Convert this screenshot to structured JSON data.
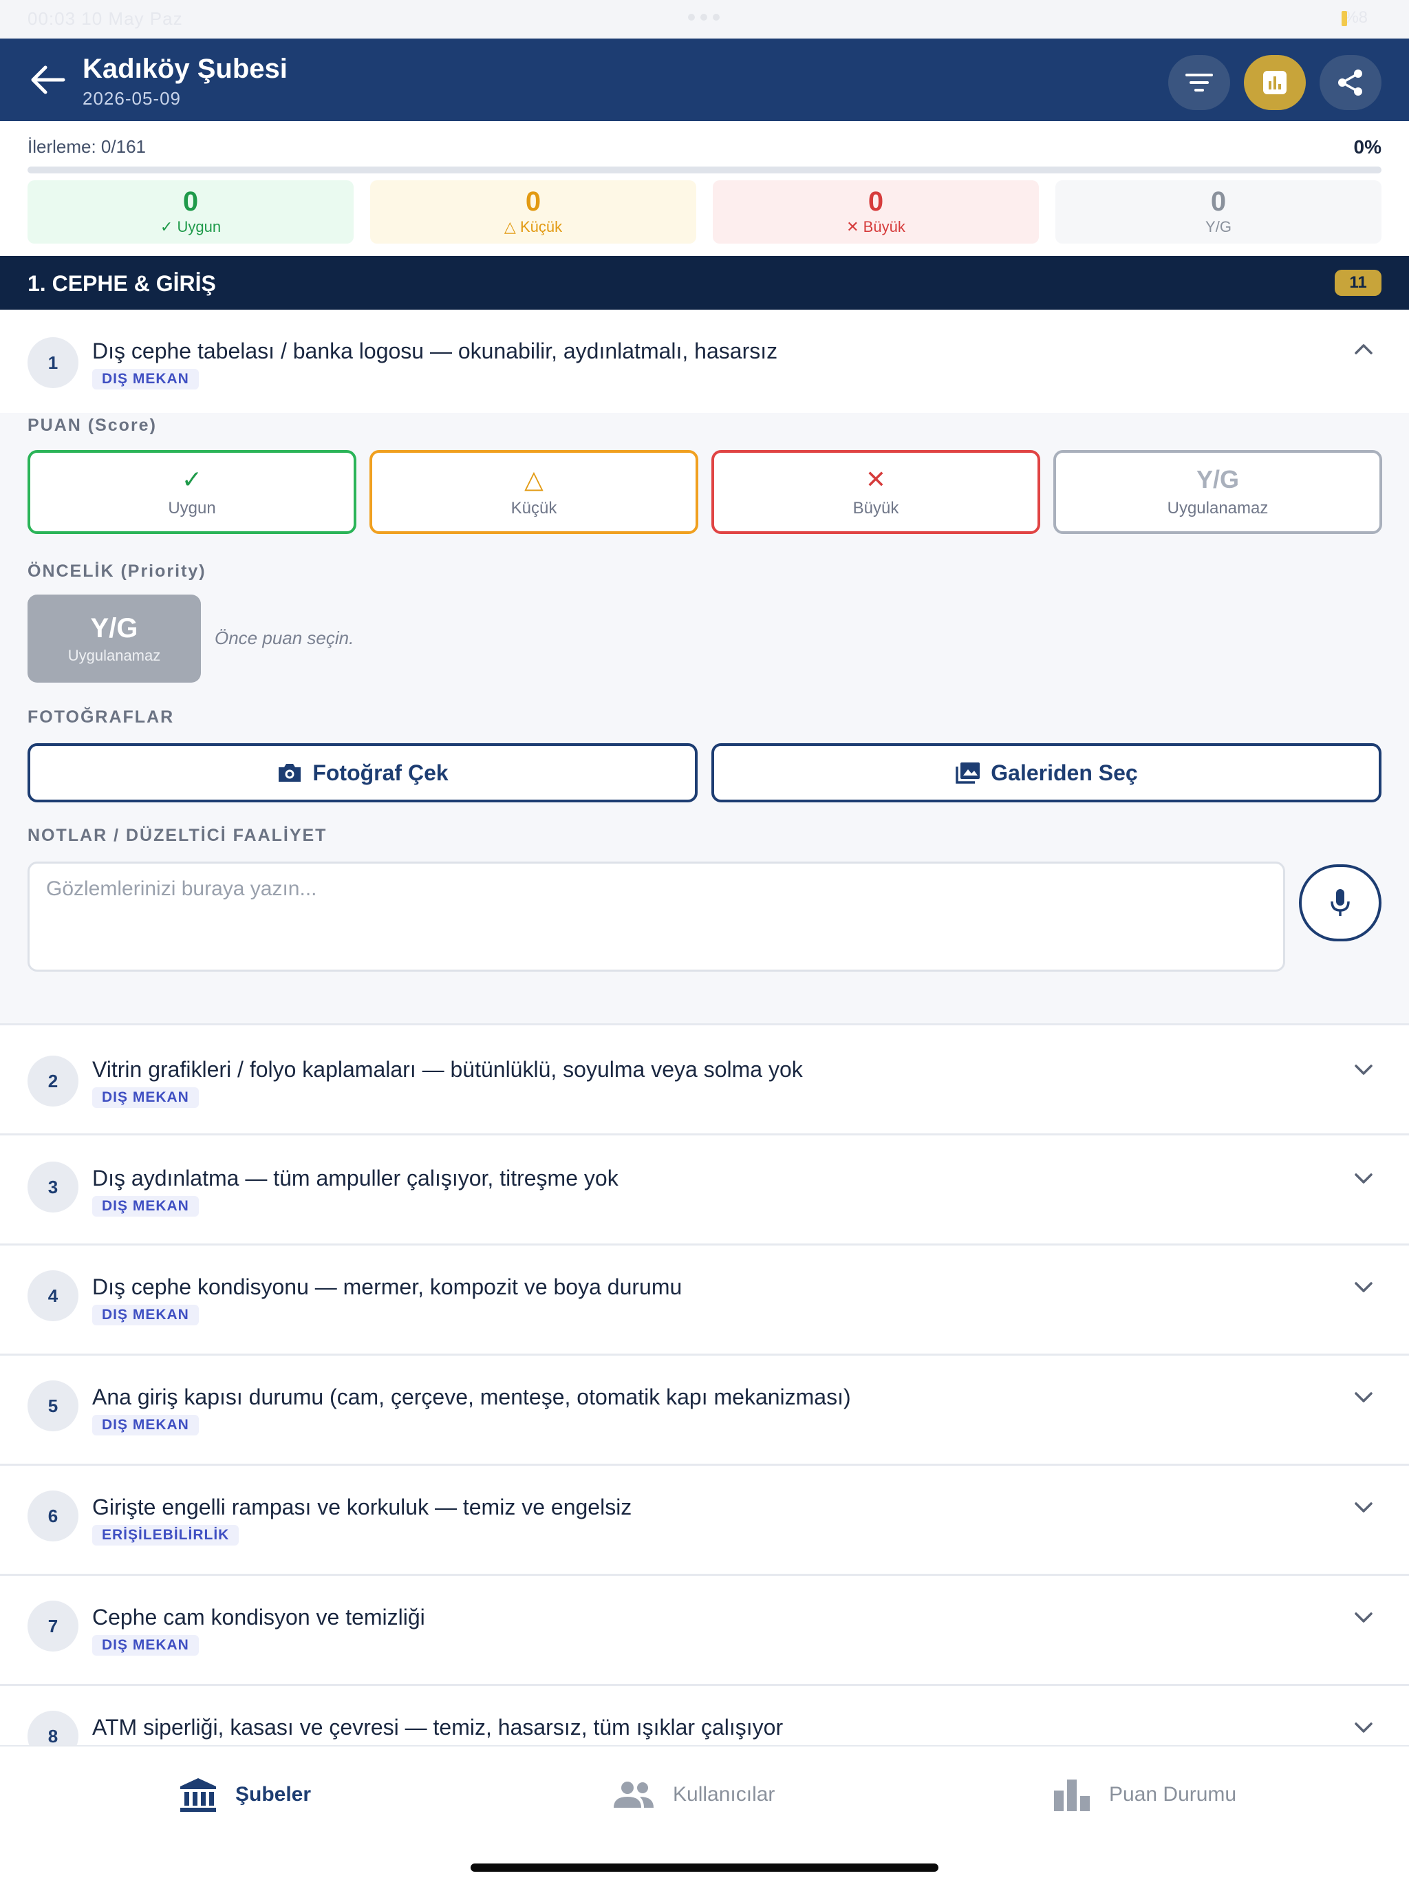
{
  "status_bar": {
    "time": "00:03  10 May Paz",
    "battery": "%8"
  },
  "header": {
    "title": "Kadıköy Şubesi",
    "subtitle": "2026-05-09"
  },
  "progress": {
    "label": "İlerleme: 0/161",
    "percent_text": "0%",
    "fraction": 0
  },
  "counters": [
    {
      "value": "0",
      "label": "✓ Uygun"
    },
    {
      "value": "0",
      "label": "△ Küçük"
    },
    {
      "value": "0",
      "label": "✕ Büyük"
    },
    {
      "value": "0",
      "label": "Y/G"
    }
  ],
  "section": {
    "title": "1. CEPHE & GİRİŞ",
    "count": "11"
  },
  "items": [
    {
      "number": "1",
      "text": "Dış cephe tabelası / banka logosu — okunabilir, aydınlatmalı, hasarsız",
      "tag": "DIŞ MEKAN"
    },
    {
      "number": "2",
      "text": "Vitrin grafikleri / folyo kaplamaları — bütünlüklü, soyulma veya solma yok",
      "tag": "DIŞ MEKAN"
    },
    {
      "number": "3",
      "text": "Dış aydınlatma — tüm ampuller çalışıyor, titreşme yok",
      "tag": "DIŞ MEKAN"
    },
    {
      "number": "4",
      "text": "Dış cephe kondisyonu — mermer, kompozit ve boya durumu",
      "tag": "DIŞ MEKAN"
    },
    {
      "number": "5",
      "text": "Ana giriş kapısı durumu (cam, çerçeve, menteşe, otomatik kapı mekanizması)",
      "tag": "DIŞ MEKAN"
    },
    {
      "number": "6",
      "text": "Girişte engelli rampası ve korkuluk — temiz ve engelsiz",
      "tag": "ERİŞİLEBİLİRLİK"
    },
    {
      "number": "7",
      "text": "Cephe cam kondisyon ve temizliği",
      "tag": "DIŞ MEKAN"
    },
    {
      "number": "8",
      "text": "ATM siperliği, kasası ve çevresi — temiz, hasarsız, tüm ışıklar çalışıyor",
      "tag": ""
    }
  ],
  "panel": {
    "score_label": "PUAN (Score)",
    "scores": [
      {
        "icon": "✓",
        "label": "Uygun"
      },
      {
        "icon": "△",
        "label": "Küçük"
      },
      {
        "icon": "✕",
        "label": "Büyük"
      },
      {
        "icon": "Y/G",
        "label": "Uygulanamaz"
      }
    ],
    "priority_label": "ÖNCELİK (Priority)",
    "priority_value": "Y/G",
    "priority_sub": "Uygulanamaz",
    "priority_hint": "Önce puan seçin.",
    "photos_label": "FOTOĞRAFLAR",
    "take_photo": "Fotoğraf Çek",
    "choose_gallery": "Galeriden Seç",
    "notes_label": "NOTLAR / DÜZELTİCİ FAALİYET",
    "notes_placeholder": "Gözlemlerinizi buraya yazın...",
    "notes_value": ""
  },
  "bottom_nav": [
    {
      "label": "Şubeler",
      "icon": "bank-icon",
      "active": true
    },
    {
      "label": "Kullanıcılar",
      "icon": "users-icon",
      "active": false
    },
    {
      "label": "Puan Durumu",
      "icon": "bar-chart-icon",
      "active": false
    }
  ],
  "colors": {
    "primary": "#1d3d72",
    "section_bg": "#0f2445",
    "gold": "#c8a43a",
    "ok": "#1f9a4a",
    "minor": "#e29a12",
    "major": "#d63c3c",
    "na": "#8a919c"
  }
}
